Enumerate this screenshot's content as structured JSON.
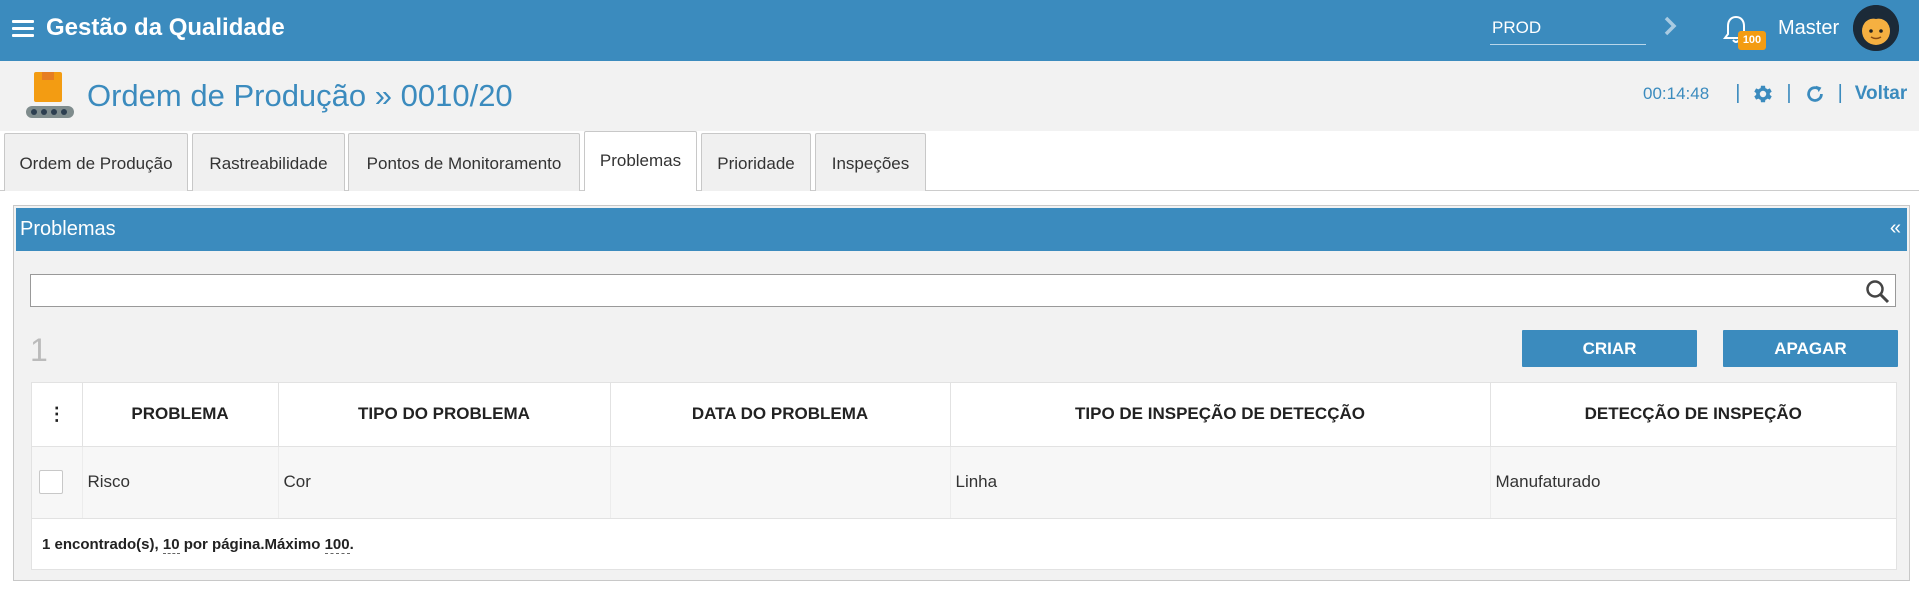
{
  "app": {
    "title": "Gestão da Qualidade"
  },
  "env": {
    "value": "PROD"
  },
  "notifications": {
    "count": "100"
  },
  "user": {
    "name": "Master"
  },
  "page": {
    "title": "Ordem de Produção » 0010/20",
    "timer": "00:14:48",
    "back_label": "Voltar",
    "separator": "|"
  },
  "tabs": [
    {
      "label": "Ordem de Produção"
    },
    {
      "label": "Rastreabilidade"
    },
    {
      "label": "Pontos de Monitoramento"
    },
    {
      "label": "Problemas"
    },
    {
      "label": "Prioridade"
    },
    {
      "label": "Inspeções"
    }
  ],
  "panel": {
    "title": "Problemas",
    "collapse_glyph": "«",
    "search_value": "",
    "count": "1",
    "create_label": "CRIAR",
    "delete_label": "APAGAR"
  },
  "table": {
    "menu_glyph": "⋮",
    "columns": [
      "PROBLEMA",
      "TIPO DO PROBLEMA",
      "DATA DO PROBLEMA",
      "TIPO DE INSPEÇÃO DE DETECÇÃO",
      "DETECÇÃO DE INSPEÇÃO"
    ],
    "rows": [
      {
        "problema": "Risco",
        "tipo": "Cor",
        "data": "",
        "tipo_inspecao": "Linha",
        "deteccao": "Manufaturado"
      }
    ],
    "footer": {
      "found": "1 encontrado(s), ",
      "per_page_value": "10",
      "per_page_label": " por página.Máximo ",
      "max_value": "100",
      "end": "."
    }
  },
  "colors": {
    "primary": "#3b8bbe",
    "badge": "#f39c12"
  },
  "icons": [
    "menu-icon",
    "chevron-right-icon",
    "bell-icon",
    "avatar",
    "factory-icon",
    "gear-icon",
    "refresh-icon",
    "search-icon"
  ]
}
